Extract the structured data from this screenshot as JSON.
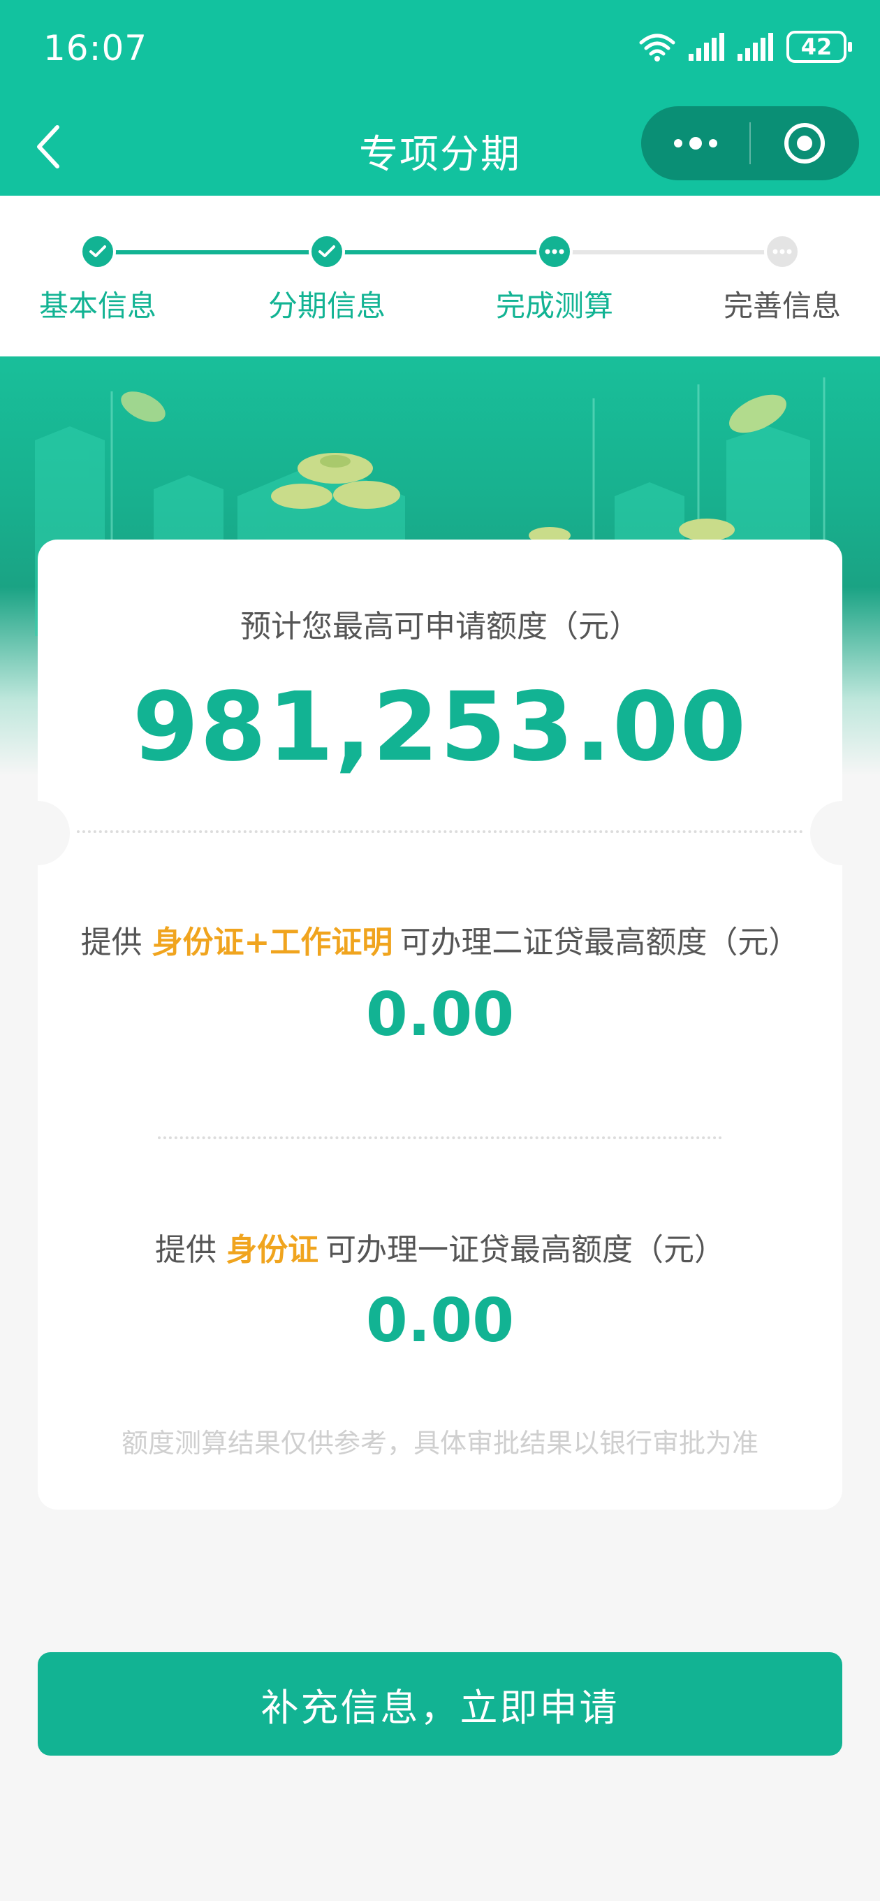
{
  "status_bar": {
    "time": "16:07",
    "battery": "42"
  },
  "nav": {
    "title": "专项分期"
  },
  "steps": [
    {
      "label": "基本信息",
      "state": "done"
    },
    {
      "label": "分期信息",
      "state": "done"
    },
    {
      "label": "完成测算",
      "state": "current"
    },
    {
      "label": "完善信息",
      "state": "todo"
    }
  ],
  "card": {
    "max_label": "预计您最高可申请额度（元）",
    "max_amount": "981,253.00",
    "two_doc": {
      "prefix": "提供",
      "highlight": "身份证+工作证明",
      "suffix": "可办理二证贷最高额度（元）",
      "amount": "0.00"
    },
    "one_doc": {
      "prefix": "提供",
      "highlight": "身份证",
      "suffix": "可办理一证贷最高额度（元）",
      "amount": "0.00"
    },
    "disclaimer": "额度测算结果仅供参考，具体审批结果以银行审批为准"
  },
  "cta": {
    "label": "补充信息，立即申请"
  },
  "colors": {
    "brand": "#12c29f",
    "accent": "#12b393",
    "highlight": "#f0a41e"
  }
}
